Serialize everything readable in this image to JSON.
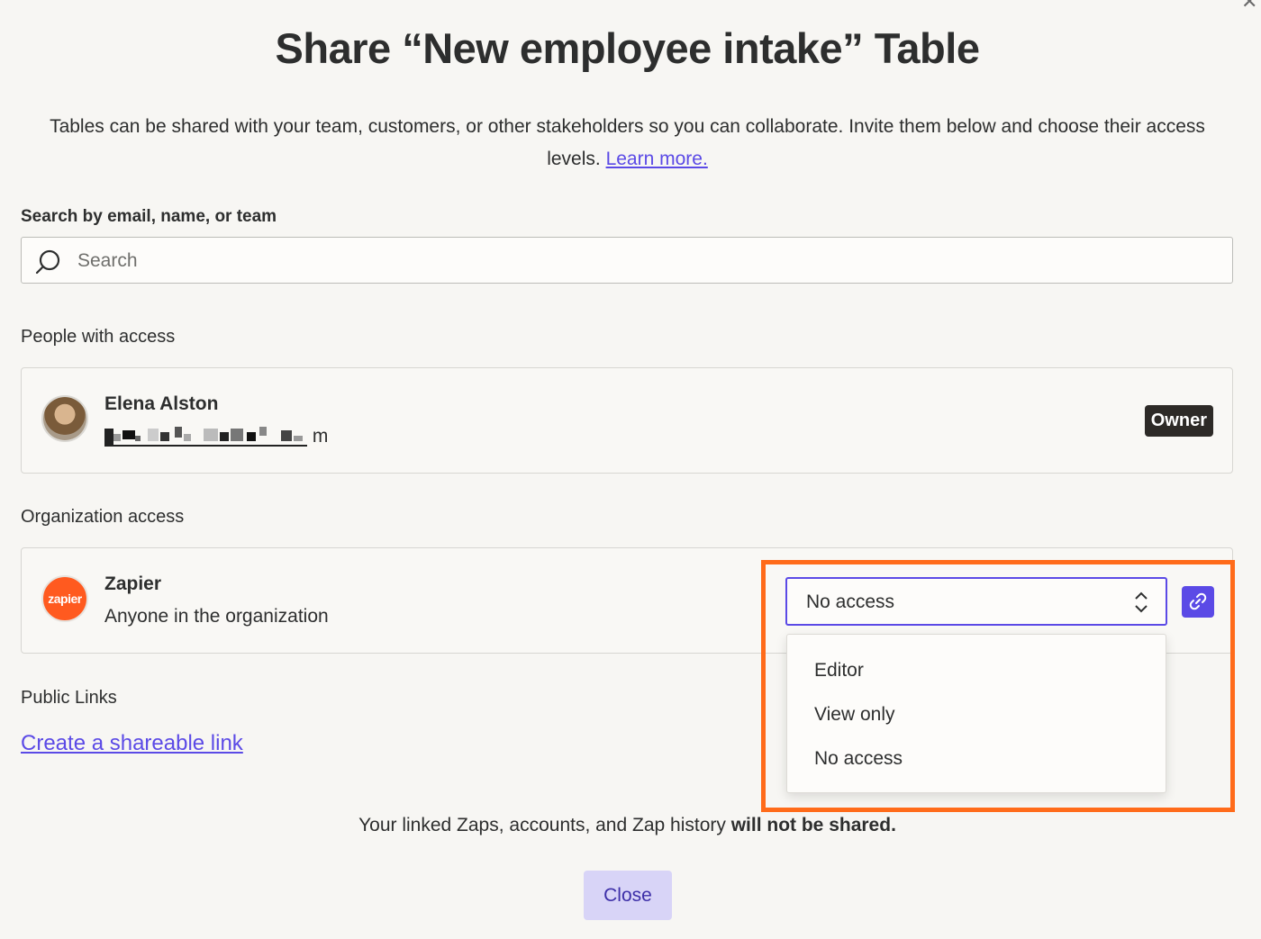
{
  "dialog": {
    "title": "Share “New employee intake” Table",
    "description": "Tables can be shared with your team, customers, or other stakeholders so you can collaborate. Invite them below and choose their access levels.",
    "learn_more": "Learn more."
  },
  "search": {
    "label": "Search by email, name, or team",
    "placeholder": "Search"
  },
  "people": {
    "label": "People with access",
    "items": [
      {
        "name": "Elena Alston",
        "email_suffix": "m",
        "role": "Owner"
      }
    ]
  },
  "organization": {
    "label": "Organization access",
    "name": "Zapier",
    "logo_text": "zapier",
    "subtitle": "Anyone in the organization",
    "access": {
      "selected": "No access",
      "options": [
        "Editor",
        "View only",
        "No access"
      ]
    }
  },
  "public_links": {
    "label": "Public Links",
    "create_link": "Create a shareable link"
  },
  "footer": {
    "note_prefix": "Your linked Zaps, accounts, and Zap history ",
    "note_bold": "will not be shared.",
    "close_label": "Close"
  },
  "colors": {
    "accent": "#5b4ae6",
    "highlight": "#ff6b1a",
    "zapier_orange": "#ff5a1f"
  }
}
